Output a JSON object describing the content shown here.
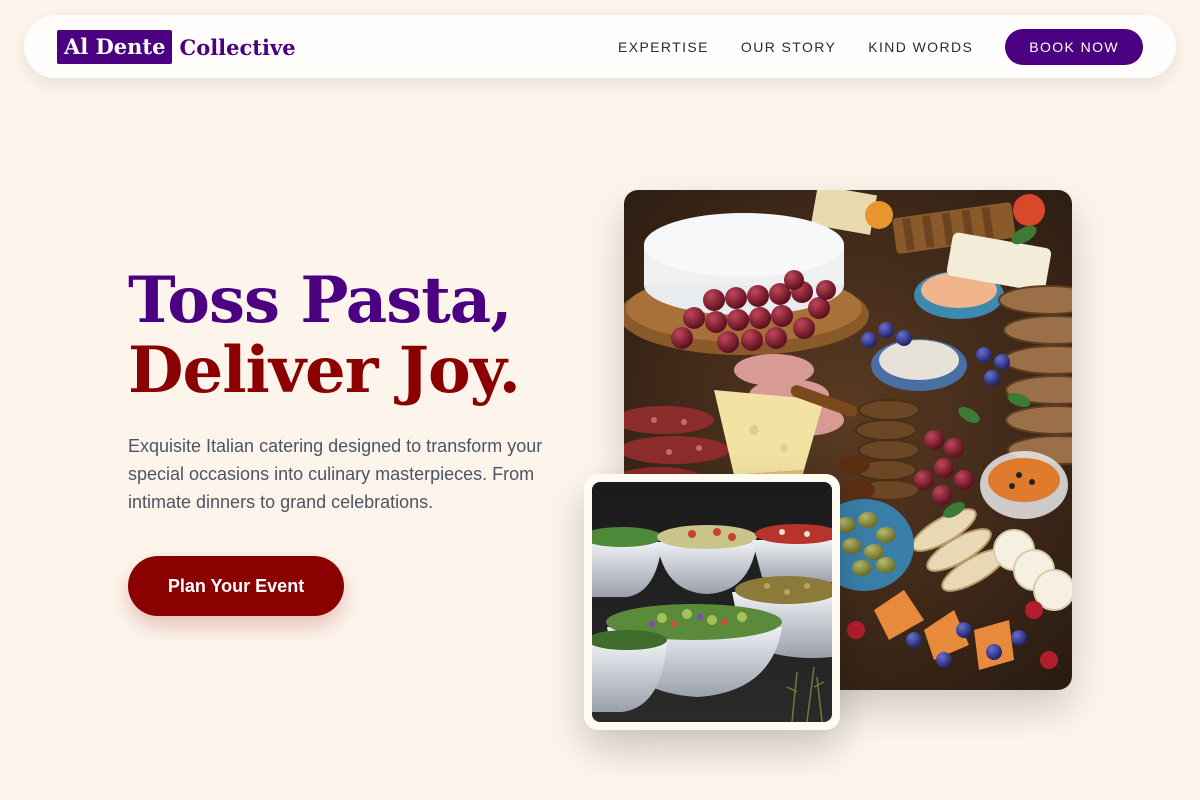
{
  "nav": {
    "logo_box_text": "Al Dente",
    "logo_text": "Collective",
    "links": [
      "EXPERTISE",
      "OUR STORY",
      "KIND WORDS"
    ],
    "book_label": "BOOK NOW"
  },
  "hero": {
    "headline_line1": "Toss Pasta,",
    "headline_line2": "Deliver Joy.",
    "subtitle": "Exquisite Italian catering designed to transform your special occasions into culinary masterpieces. From intimate dinners to grand celebrations.",
    "cta_label": "Plan Your Event"
  },
  "images": {
    "main": "charcuterie-board-image",
    "secondary": "salad-bowls-image"
  },
  "colors": {
    "background": "#fdf5ec",
    "primary": "#4b0082",
    "accent": "#8b0000",
    "body_text": "#4b5563"
  }
}
